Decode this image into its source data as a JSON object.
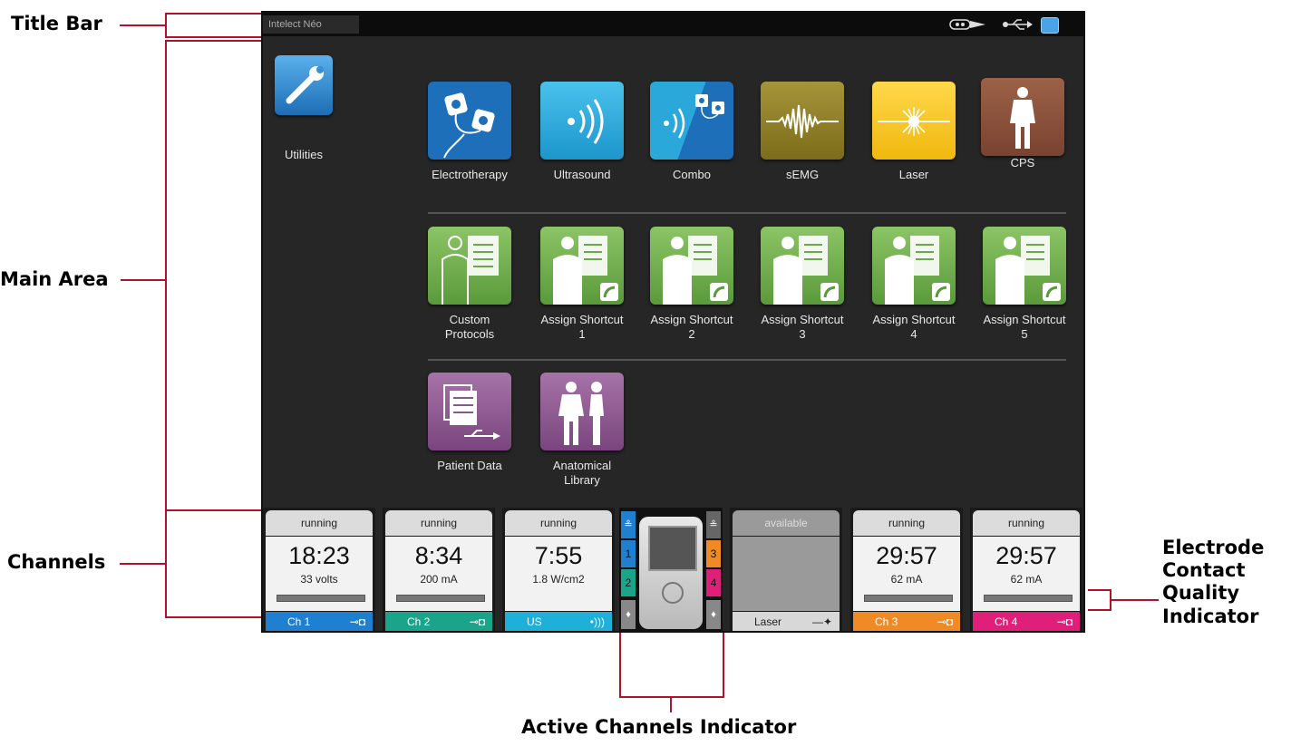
{
  "annotations": {
    "title_bar": "Title Bar",
    "main_area": "Main Area",
    "channels": "Channels",
    "active_channels_indicator": "Active Channels Indicator",
    "electrode_line1": "Electrode",
    "electrode_line2": "Contact",
    "electrode_line3": "Quality",
    "electrode_line4": "Indicator"
  },
  "titlebar": {
    "title": "Intelect Néo"
  },
  "utilities": {
    "label": "Utilities"
  },
  "modalities": [
    {
      "label": "Electrotherapy",
      "icon": "electrodes-icon",
      "color": "#1c6fb8"
    },
    {
      "label": "Ultrasound",
      "icon": "ultrasound-waves-icon",
      "color": "#1fa6d6"
    },
    {
      "label": "Combo",
      "icon": "combo-icon",
      "color": "#1c6fb8"
    },
    {
      "label": "sEMG",
      "icon": "emg-waveform-icon",
      "color": "#8a7a22"
    },
    {
      "label": "Laser",
      "icon": "laser-icon",
      "color": "#f2c21a"
    },
    {
      "label": "CPS",
      "icon": "body-figure-icon",
      "color": "#8a5238"
    }
  ],
  "protocols": [
    {
      "line1": "Custom",
      "line2": "Protocols"
    },
    {
      "line1": "Assign Shortcut",
      "line2": "1"
    },
    {
      "line1": "Assign Shortcut",
      "line2": "2"
    },
    {
      "line1": "Assign Shortcut",
      "line2": "3"
    },
    {
      "line1": "Assign Shortcut",
      "line2": "4"
    },
    {
      "line1": "Assign Shortcut",
      "line2": "5"
    }
  ],
  "library": [
    {
      "line1": "Patient Data",
      "line2": ""
    },
    {
      "line1": "Anatomical",
      "line2": "Library"
    }
  ],
  "channels": [
    {
      "status": "running",
      "time": "18:23",
      "value": "33 volts",
      "name": "Ch 1",
      "color": "#1f7fd0"
    },
    {
      "status": "running",
      "time": "8:34",
      "value": "200 mA",
      "name": "Ch 2",
      "color": "#1aa58a"
    },
    {
      "status": "running",
      "time": "7:55",
      "value": "1.8 W/cm2",
      "name": "US",
      "color": "#1fb0da"
    },
    {
      "status": "available",
      "time": "",
      "value": "",
      "name": "Laser",
      "color": "#a9a9a9"
    },
    {
      "status": "running",
      "time": "29:57",
      "value": "62 mA",
      "name": "Ch 3",
      "color": "#f08a24"
    },
    {
      "status": "running",
      "time": "29:57",
      "value": "62 mA",
      "name": "Ch 4",
      "color": "#e01f7a"
    }
  ],
  "active_indicator": {
    "left_1": "1",
    "left_2": "2",
    "right_3": "3",
    "right_4": "4"
  }
}
